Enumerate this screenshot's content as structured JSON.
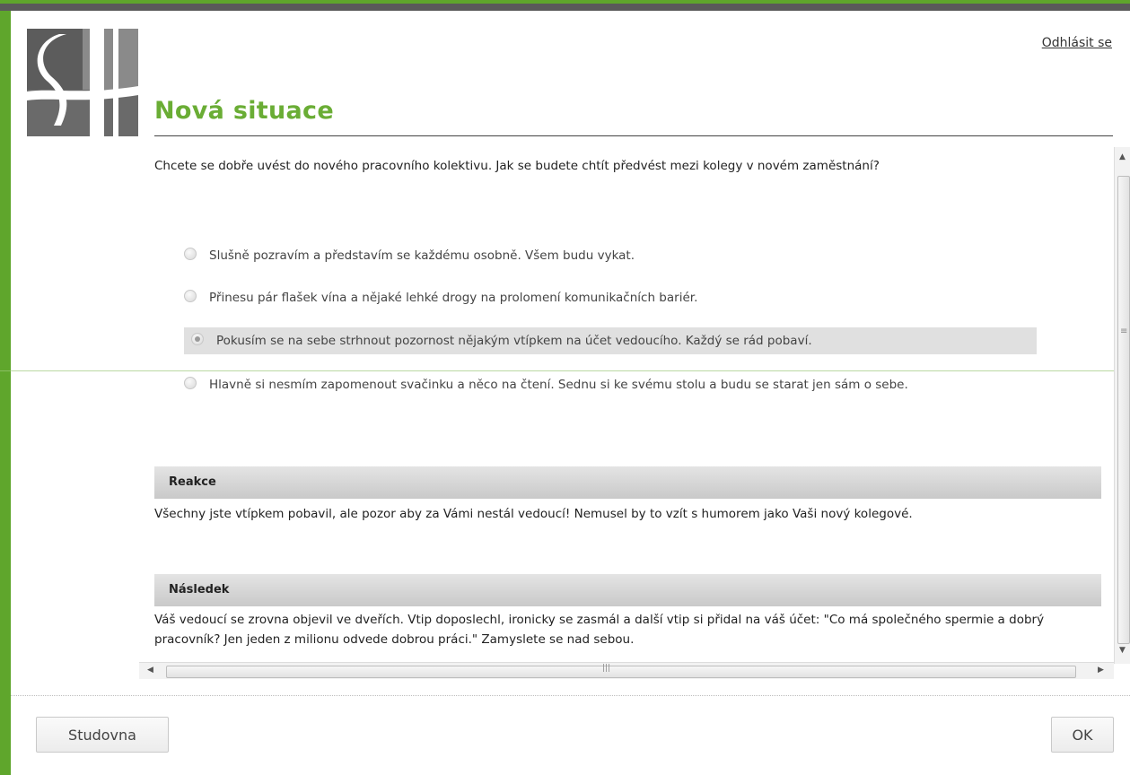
{
  "header": {
    "logout_label": "Odhlásit se",
    "title": "Nová situace"
  },
  "question": {
    "text": "Chcete se dobře uvést do nového pracovního kolektivu. Jak se budete chtít předvést mezi kolegy v novém zaměstnání?"
  },
  "options": [
    {
      "label": "Slušně pozravím a představím se každému osobně. Všem budu vykat.",
      "selected": false
    },
    {
      "label": "Přinesu pár flašek vína a nějaké lehké drogy na prolomení komunikačních bariér.",
      "selected": false
    },
    {
      "label": "Pokusím se na sebe strhnout pozornost nějakým vtípkem na účet vedoucího. Každý se rád pobaví.",
      "selected": true
    },
    {
      "label": "Hlavně si nesmím zapomenout svačinku a něco na čtení. Sednu si ke svému stolu a budu se starat jen sám o sebe.",
      "selected": false
    }
  ],
  "reaction": {
    "heading": "Reakce",
    "text": "Všechny jste vtípkem pobavil, ale pozor aby za Vámi nestál vedoucí! Nemusel by to vzít s humorem jako Vaši nový kolegové."
  },
  "consequence": {
    "heading": "Následek",
    "text": "Váš vedoucí se zrovna objevil ve dveřích. Vtip doposlechl, ironicky se zasmál a další vtip si přidal na váš účet: \"Co má společného spermie a dobrý pracovník? Jen jeden z milionu odvede dobrou práci.\" Zamyslete se nad sebou."
  },
  "footer": {
    "left_button": "Studovna",
    "right_button": "OK"
  },
  "icons": {
    "logo": "sh-logo-icon",
    "scroll_up": "scroll-up-arrow-icon",
    "scroll_down": "scroll-down-arrow-icon",
    "scroll_left": "scroll-left-arrow-icon",
    "scroll_right": "scroll-right-arrow-icon"
  },
  "colors": {
    "brand_green": "#6aad35",
    "frame_green": "#5fa62c"
  }
}
